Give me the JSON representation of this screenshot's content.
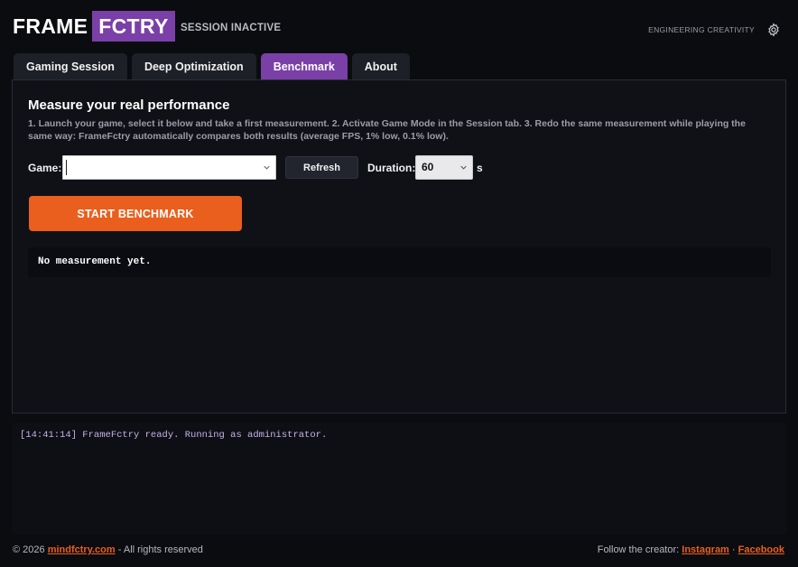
{
  "header": {
    "logo_part1": "FRAME",
    "logo_part2": "FCTRY",
    "session_status": "SESSION INACTIVE",
    "tagline": "ENGINEERING CREATIVITY",
    "settings_icon": "gear-icon"
  },
  "tabs": [
    {
      "label": "Gaming Session",
      "active": false
    },
    {
      "label": "Deep Optimization",
      "active": false
    },
    {
      "label": "Benchmark",
      "active": true
    },
    {
      "label": "About",
      "active": false
    }
  ],
  "benchmark": {
    "title": "Measure your real performance",
    "description": "1. Launch your game, select it below and take a first measurement.  2. Activate Game Mode in the Session tab.  3. Redo the same measurement while playing the same way: FrameFctry automatically compares both results (average FPS, 1% low, 0.1% low).",
    "game_label": "Game:",
    "game_value": "",
    "refresh_label": "Refresh",
    "duration_label": "Duration:",
    "duration_value": "60",
    "duration_unit": "s",
    "start_label": "START BENCHMARK",
    "result_text": "No measurement yet."
  },
  "log": {
    "lines": [
      "[14:41:14] FrameFctry ready. Running as administrator."
    ]
  },
  "footer": {
    "copyright_prefix": "© 2026",
    "site_link": "mindfctry.com",
    "copyright_suffix": "- All rights reserved",
    "follow_label": "Follow the creator:",
    "instagram_link": "Instagram",
    "separator": "·",
    "facebook_link": "Facebook"
  },
  "colors": {
    "brand_purple": "#7b3fa8",
    "accent_orange": "#ea5f1d",
    "background": "#0b0c10",
    "log_text": "#c5b2e6"
  }
}
